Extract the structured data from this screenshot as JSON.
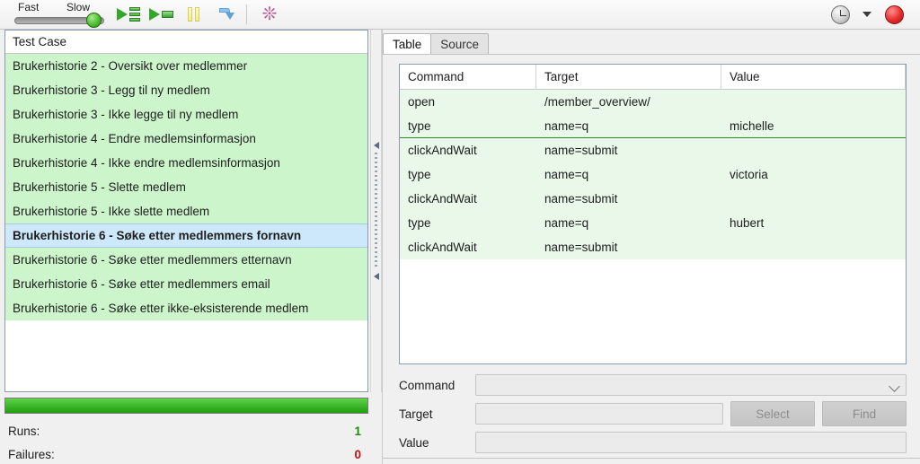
{
  "toolbar": {
    "speed": {
      "fast_label": "Fast",
      "slow_label": "Slow",
      "position": "slow"
    },
    "buttons": [
      {
        "name": "run-all-tests-button",
        "icon": "play-multiple-icon",
        "label": ""
      },
      {
        "name": "run-current-test-button",
        "icon": "play-single-icon",
        "label": ""
      },
      {
        "name": "pause-button",
        "icon": "pause-icon",
        "label": ""
      },
      {
        "name": "step-button",
        "icon": "step-icon",
        "label": ""
      },
      {
        "name": "rollup-button",
        "icon": "spiral-icon",
        "label": ""
      }
    ],
    "history_icon": "clock-icon",
    "history_caret": "chevron-down-icon",
    "record_icon": "record-icon"
  },
  "left_panel": {
    "header": "Test Case",
    "test_cases": [
      {
        "label": "Brukerhistorie 2 - Oversikt over medlemmer",
        "selected": false
      },
      {
        "label": "Brukerhistorie 3 - Legg til ny medlem",
        "selected": false
      },
      {
        "label": "Brukerhistorie 3 - Ikke legge til ny medlem",
        "selected": false
      },
      {
        "label": "Brukerhistorie 4 - Endre medlemsinformasjon",
        "selected": false
      },
      {
        "label": "Brukerhistorie 4 - Ikke endre medlemsinformasjon",
        "selected": false
      },
      {
        "label": "Brukerhistorie 5 - Slette medlem",
        "selected": false
      },
      {
        "label": "Brukerhistorie 5 - Ikke slette medlem",
        "selected": false
      },
      {
        "label": "Brukerhistorie 6 - Søke etter medlemmers fornavn",
        "selected": true
      },
      {
        "label": "Brukerhistorie 6 - Søke etter medlemmers etternavn",
        "selected": false
      },
      {
        "label": "Brukerhistorie 6 - Søke etter medlemmers email",
        "selected": false
      },
      {
        "label": "Brukerhistorie 6 - Søke etter ikke-eksisterende medlem",
        "selected": false
      }
    ],
    "progress_percent": 100,
    "stats": [
      {
        "label": "Runs:",
        "value": "1",
        "state": "ok"
      },
      {
        "label": "Failures:",
        "value": "0",
        "state": "bad"
      }
    ]
  },
  "right_panel": {
    "tabs": [
      {
        "label": "Table",
        "active": true
      },
      {
        "label": "Source",
        "active": false
      }
    ],
    "table": {
      "columns": [
        "Command",
        "Target",
        "Value"
      ],
      "rows": [
        {
          "command": "open",
          "target": "/member_overview/",
          "value": "",
          "group_end": false
        },
        {
          "command": "type",
          "target": "name=q",
          "value": "michelle",
          "group_end": true
        },
        {
          "command": "clickAndWait",
          "target": "name=submit",
          "value": "",
          "group_end": false
        },
        {
          "command": "type",
          "target": "name=q",
          "value": "victoria",
          "group_end": false
        },
        {
          "command": "clickAndWait",
          "target": "name=submit",
          "value": "",
          "group_end": false
        },
        {
          "command": "type",
          "target": "name=q",
          "value": "hubert",
          "group_end": false
        },
        {
          "command": "clickAndWait",
          "target": "name=submit",
          "value": "",
          "group_end": false
        }
      ]
    },
    "editor": {
      "command_label": "Command",
      "command_value": "",
      "target_label": "Target",
      "target_value": "",
      "value_label": "Value",
      "value_value": "",
      "select_button": "Select",
      "find_button": "Find"
    }
  },
  "colors": {
    "list_green": "#ccf5cc",
    "selection_blue": "#cde8fa",
    "table_green": "#e9f8e9",
    "progress_green": "#1e9e0d",
    "runs_green": "#1e8a0d",
    "failures_red": "#c41212",
    "record_red": "#e62d2d"
  }
}
